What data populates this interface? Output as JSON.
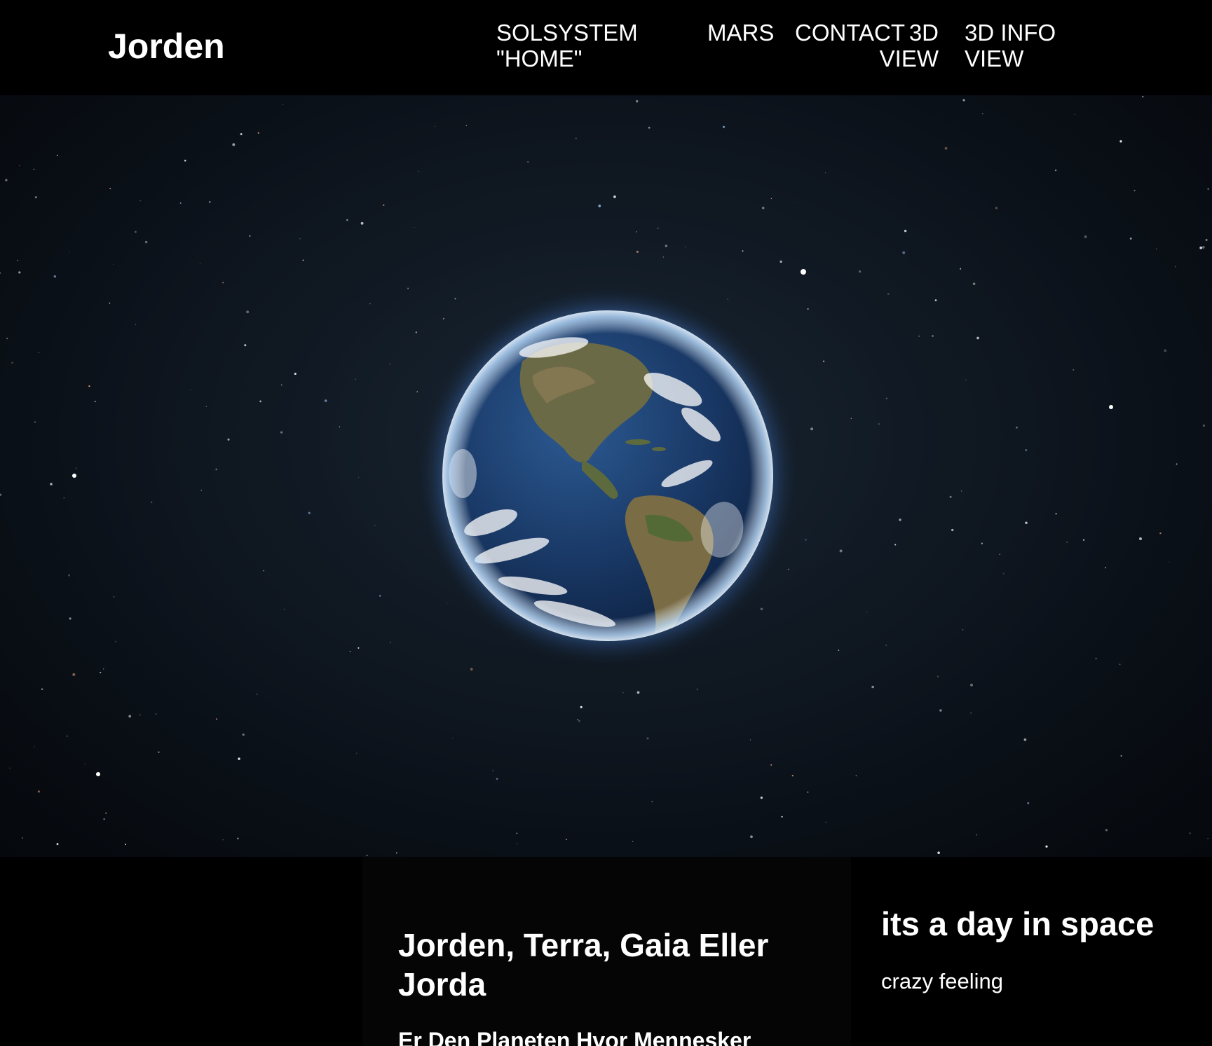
{
  "header": {
    "logo": "Jorden",
    "nav": [
      {
        "label": "SOLSYSTEM\n\"HOME\""
      },
      {
        "label": "MARS"
      },
      {
        "label": "CONTACT"
      },
      {
        "label": "3D\nVIEW"
      },
      {
        "label": "3D INFO\nVIEW"
      }
    ]
  },
  "hero": {
    "image": "earth-from-space"
  },
  "article": {
    "title": "Jorden, Terra, Gaia Eller Jorda",
    "subtitle": "Er Den Planeten Hvor Mennesker"
  },
  "aside": {
    "title": "its a day in space",
    "text": "crazy feeling"
  },
  "colors": {
    "background": "#000000",
    "text": "#ffffff",
    "ocean": "#1d3f6e",
    "atmosphere": "#7fb8ff"
  }
}
